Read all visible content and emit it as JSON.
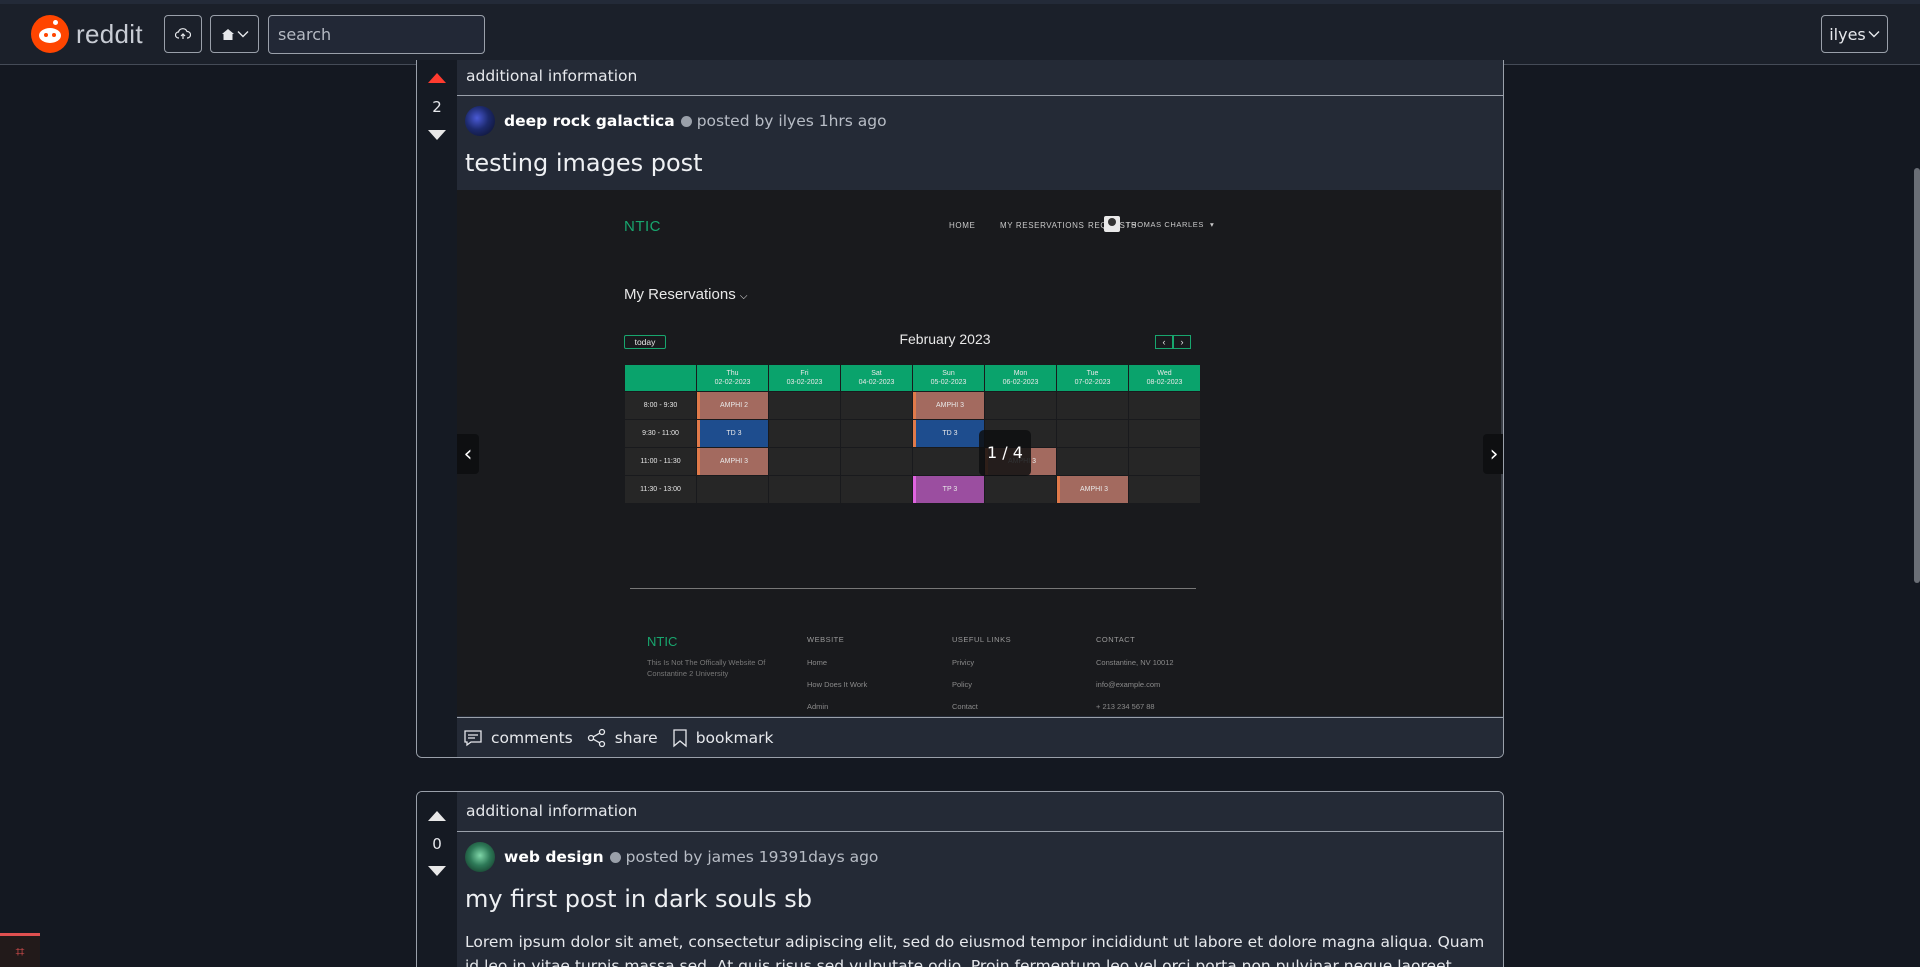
{
  "header": {
    "logo_text": "reddit",
    "search_placeholder": "search",
    "user_label": "ilyes",
    "icons": [
      "reddit-logo-icon",
      "cloud-upload-icon",
      "home-icon",
      "chevron-down-icon"
    ]
  },
  "posts": [
    {
      "additional_info": "additional information",
      "score": "2",
      "upvoted": true,
      "community": "deep rock galactica",
      "posted_by": "posted by ilyes 1hrs ago",
      "title": "testing images post",
      "gallery_counter": "1 / 4",
      "image": {
        "logo": "NTIC",
        "nav": [
          "HOME",
          "MY RESERVATIONS",
          "REQUESTS"
        ],
        "user": "THOMAS CHARLES",
        "heading": "My Reservations",
        "today": "today",
        "month": "February 2023",
        "days": [
          {
            "day": "Thu",
            "date": "02-02-2023"
          },
          {
            "day": "Fri",
            "date": "03-02-2023"
          },
          {
            "day": "Sat",
            "date": "04-02-2023"
          },
          {
            "day": "Sun",
            "date": "05-02-2023"
          },
          {
            "day": "Mon",
            "date": "06-02-2023"
          },
          {
            "day": "Tue",
            "date": "07-02-2023"
          },
          {
            "day": "Wed",
            "date": "08-02-2023"
          }
        ],
        "rows": [
          {
            "time": "8:00 - 9:30",
            "cells": [
              "AMPHI 2",
              "",
              "",
              "AMPHI 3",
              "",
              "",
              ""
            ]
          },
          {
            "time": "9:30 - 11:00",
            "cells": [
              "TD 3",
              "",
              "",
              "TD 3",
              "",
              "",
              ""
            ]
          },
          {
            "time": "11:00 - 11:30",
            "cells": [
              "AMPHI 3",
              "",
              "",
              "",
              "AMPHI 3",
              "",
              ""
            ]
          },
          {
            "time": "11:30 - 13:00",
            "cells": [
              "",
              "",
              "",
              "TP 3",
              "",
              "AMPHI 3",
              ""
            ]
          }
        ],
        "footer": {
          "logo": "NTIC",
          "about": "This Is Not The Offically Website Of Constantine 2 University",
          "website_title": "WEBSITE",
          "website_links": [
            "Home",
            "How Does It Work",
            "Admin"
          ],
          "useful_title": "USEFUL LINKS",
          "useful_links": [
            "Privicy",
            "Policy",
            "Contact"
          ],
          "contact_title": "CONTACT",
          "contact_lines": [
            "Constantine, NV 10012",
            "info@example.com",
            "+ 213 234 567 88"
          ]
        }
      },
      "actions": {
        "comments": "comments",
        "share": "share",
        "bookmark": "bookmark"
      }
    },
    {
      "additional_info": "additional information",
      "score": "0",
      "upvoted": false,
      "community": "web design",
      "posted_by": "posted by james 19391days ago",
      "title": "my first post in dark souls sb",
      "body": "Lorem ipsum dolor sit amet, consectetur adipiscing elit, sed do eiusmod tempor incididunt ut labore et dolore magna aliqua. Quam id leo in vitae turpis massa sed. At quis risus sed vulputate odio. Proin fermentum leo vel orci porta non pulvinar neque laoreet. Massa ultricies mi"
    }
  ],
  "colors": {
    "accent_upvote": "#ff3b2f",
    "ntic_green": "#0aa36c",
    "background": "#141821",
    "card": "#242a36"
  }
}
